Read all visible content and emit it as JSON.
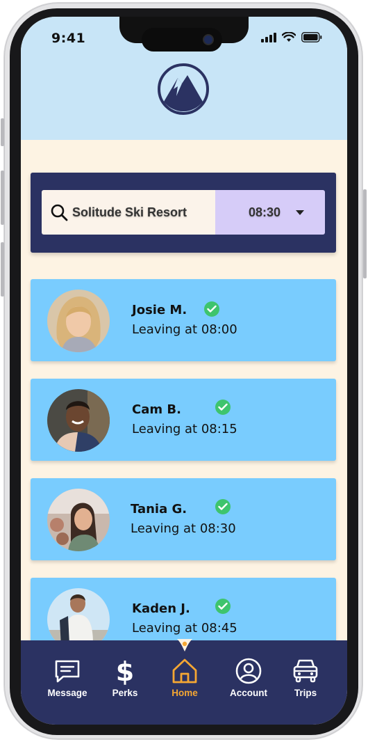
{
  "status_bar": {
    "time": "9:41"
  },
  "search": {
    "location": "Solitude Ski Resort",
    "time": "08:30"
  },
  "rides": [
    {
      "name": "Josie M.",
      "leaving": "Leaving at 08:00",
      "verified": true
    },
    {
      "name": "Cam B.",
      "leaving": "Leaving at 08:15",
      "verified": true
    },
    {
      "name": "Tania G.",
      "leaving": "Leaving at 08:30",
      "verified": true
    },
    {
      "name": "Kaden J.",
      "leaving": "Leaving at 08:45",
      "verified": true
    }
  ],
  "nav": {
    "items": [
      {
        "label": "Message",
        "icon": "message-icon"
      },
      {
        "label": "Perks",
        "icon": "dollar-icon"
      },
      {
        "label": "Home",
        "icon": "home-icon",
        "active": true
      },
      {
        "label": "Account",
        "icon": "account-icon"
      },
      {
        "label": "Trips",
        "icon": "car-icon"
      }
    ]
  },
  "colors": {
    "header_bg": "#c8e5f7",
    "page_bg": "#fdf3e3",
    "panel_navy": "#2b3262",
    "card_blue": "#79ccfe",
    "time_select_bg": "#d6ccf8",
    "accent_orange": "#f5a733",
    "verified_green": "#3ec46d"
  }
}
